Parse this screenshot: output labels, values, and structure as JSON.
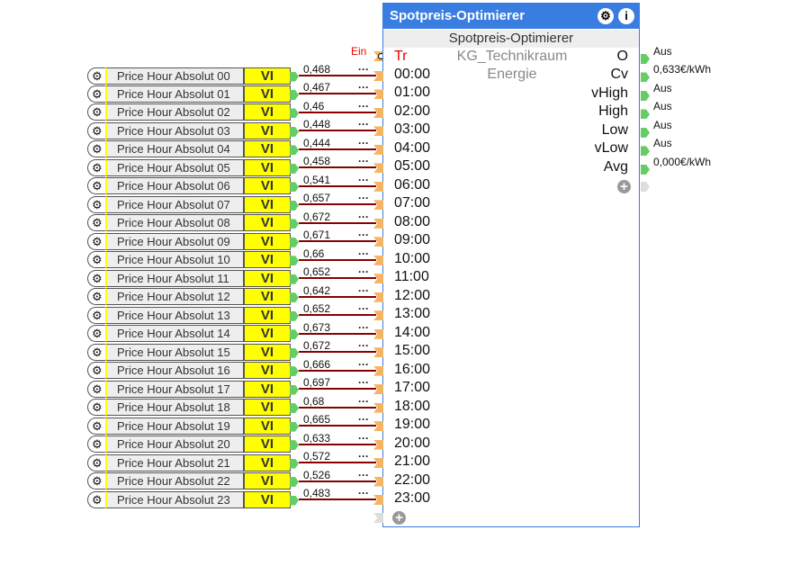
{
  "block": {
    "title": "Spotpreis-Optimierer",
    "subtitle": "Spotpreis-Optimierer",
    "room": "KG_Technikraum",
    "category": "Energie",
    "trigger_label": "Ein",
    "trigger_input": "Tr",
    "inputs": [
      "00:00",
      "01:00",
      "02:00",
      "03:00",
      "04:00",
      "05:00",
      "06:00",
      "07:00",
      "08:00",
      "09:00",
      "10:00",
      "11:00",
      "12:00",
      "13:00",
      "14:00",
      "15:00",
      "16:00",
      "17:00",
      "18:00",
      "19:00",
      "20:00",
      "21:00",
      "22:00",
      "23:00"
    ],
    "outputs": [
      {
        "label": "O",
        "value": "Aus"
      },
      {
        "label": "Cv",
        "value": "0,633€/kWh"
      },
      {
        "label": "vHigh",
        "value": "Aus"
      },
      {
        "label": "High",
        "value": "Aus"
      },
      {
        "label": "Low",
        "value": "Aus"
      },
      {
        "label": "vLow",
        "value": "Aus"
      },
      {
        "label": "Avg",
        "value": "0,000€/kWh"
      }
    ]
  },
  "sources": {
    "type_label": "VI",
    "dots": "···",
    "items": [
      {
        "name": "Price Hour Absolut 00",
        "value": "0,468"
      },
      {
        "name": "Price Hour Absolut 01",
        "value": "0,467"
      },
      {
        "name": "Price Hour Absolut 02",
        "value": "0,46"
      },
      {
        "name": "Price Hour Absolut 03",
        "value": "0,448"
      },
      {
        "name": "Price Hour Absolut 04",
        "value": "0,444"
      },
      {
        "name": "Price Hour Absolut 05",
        "value": "0,458"
      },
      {
        "name": "Price Hour Absolut 06",
        "value": "0,541"
      },
      {
        "name": "Price Hour Absolut 07",
        "value": "0,657"
      },
      {
        "name": "Price Hour Absolut 08",
        "value": "0,672"
      },
      {
        "name": "Price Hour Absolut 09",
        "value": "0,671"
      },
      {
        "name": "Price Hour Absolut 10",
        "value": "0,66"
      },
      {
        "name": "Price Hour Absolut 11",
        "value": "0,652"
      },
      {
        "name": "Price Hour Absolut 12",
        "value": "0,642"
      },
      {
        "name": "Price Hour Absolut 13",
        "value": "0,652"
      },
      {
        "name": "Price Hour Absolut 14",
        "value": "0,673"
      },
      {
        "name": "Price Hour Absolut 15",
        "value": "0,672"
      },
      {
        "name": "Price Hour Absolut 16",
        "value": "0,666"
      },
      {
        "name": "Price Hour Absolut 17",
        "value": "0,697"
      },
      {
        "name": "Price Hour Absolut 18",
        "value": "0,68"
      },
      {
        "name": "Price Hour Absolut 19",
        "value": "0,665"
      },
      {
        "name": "Price Hour Absolut 20",
        "value": "0,633"
      },
      {
        "name": "Price Hour Absolut 21",
        "value": "0,572"
      },
      {
        "name": "Price Hour Absolut 22",
        "value": "0,526"
      },
      {
        "name": "Price Hour Absolut 23",
        "value": "0,483"
      }
    ]
  },
  "colors": {
    "header": "#3a7de0",
    "wire": "#880000",
    "port_in": "#f5b461",
    "port_out": "#66cc66",
    "vi": "#ffff00"
  }
}
